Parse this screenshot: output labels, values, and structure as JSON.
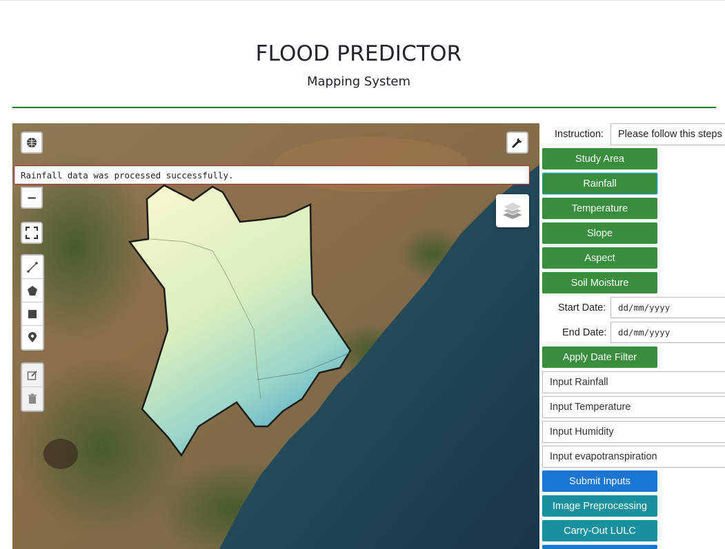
{
  "header": {
    "title": "FLOOD PREDICTOR",
    "subtitle": "Mapping System"
  },
  "map": {
    "status_message": "Rainfall data was processed successfully.",
    "controls": {
      "zoom_out_label": "−",
      "icons": [
        "globe-icon",
        "wrench-icon",
        "fullscreen-icon",
        "polyline-icon",
        "polygon-icon",
        "rectangle-icon",
        "marker-icon",
        "edit-icon",
        "trash-icon",
        "layers-icon"
      ]
    }
  },
  "panel": {
    "instruction": {
      "label": "Instruction:",
      "value": "Please follow this steps"
    },
    "buttons": {
      "study_area": "Study Area",
      "rainfall": "Rainfall",
      "temperature": "Temperature",
      "slope": "Slope",
      "aspect": "Aspect",
      "soil_moisture": "Soil Moisture",
      "apply_date_filter": "Apply Date Filter",
      "submit_inputs": "Submit Inputs",
      "image_preprocessing": "Image Preprocessing",
      "carry_out_lulc": "Carry-Out LULC"
    },
    "start_date": {
      "label": "Start Date:",
      "placeholder": "dd/mm/yyyy"
    },
    "end_date": {
      "label": "End Date:",
      "placeholder": "dd/mm/yyyy"
    },
    "inputs": {
      "rainfall": "Input Rainfall",
      "temperature": "Input Temperature",
      "humidity": "Input Humidity",
      "evapotranspiration": "Input evapotranspiration"
    }
  },
  "colors": {
    "green_button": "#388e3c",
    "blue_button": "#1976d2",
    "teal_button": "#17919e",
    "divider": "#1e7a2a"
  }
}
